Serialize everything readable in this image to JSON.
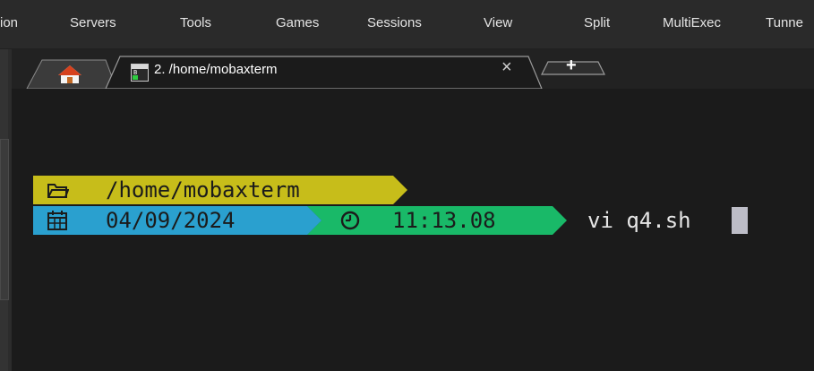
{
  "menu": {
    "items": [
      "ion",
      "Servers",
      "Tools",
      "Games",
      "Sessions",
      "View",
      "Split",
      "MultiExec",
      "Tunne"
    ]
  },
  "tabs": {
    "home_icon": "home-icon",
    "active_tab": {
      "icon": "terminal-icon",
      "label": "2. /home/mobaxterm",
      "close_glyph": "×"
    },
    "new_tab_glyph": "+"
  },
  "prompt": {
    "path": "/home/mobaxterm",
    "date": "04/09/2024",
    "time": "11:13.08",
    "command": "vi q4.sh",
    "colors": {
      "path_bg": "#c7bd1a",
      "date_bg": "#2aa0cf",
      "time_bg": "#19b968",
      "text_dark": "#1b1b1b",
      "command_text": "#e6e6e6"
    }
  }
}
